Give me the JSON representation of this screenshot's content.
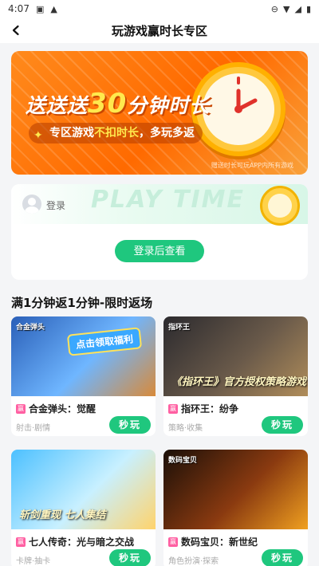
{
  "status_bar": {
    "time": "4:07"
  },
  "nav": {
    "title": "玩游戏赢时长专区"
  },
  "banner": {
    "headline_prefix": "送送送",
    "headline_number": "30",
    "headline_suffix": "分钟时长",
    "sub_part1": "专区游戏",
    "sub_highlight": "不扣时长",
    "sub_part2": "，多玩多返",
    "note": "赠送时长可玩APP内所有游戏"
  },
  "login_card": {
    "bg_text": "PLAY TIME",
    "login_label": "登录",
    "login_button": "登录后查看"
  },
  "section": {
    "title": "满1分钟返1分钟-限时返场"
  },
  "games": [
    {
      "tag": "赢",
      "name": "合金弹头：觉醒",
      "genre": "射击·剧情",
      "play": "秒玩",
      "cover_logo": "合金弹头",
      "cover_badge": "点击领取福利",
      "cover_colors": [
        "#2a5fb8",
        "#6fb6ff",
        "#d88a3a"
      ]
    },
    {
      "tag": "赢",
      "name": "指环王：纷争",
      "genre": "策略·收集",
      "play": "秒玩",
      "cover_logo": "指环王",
      "cover_text": "《指环王》官方授权策略游戏",
      "cover_colors": [
        "#2b2a2e",
        "#6a5a4a",
        "#b08d5a"
      ]
    },
    {
      "tag": "赢",
      "name": "七人传奇：光与暗之交战",
      "genre": "卡牌·抽卡",
      "play": "秒玩",
      "cover_text": "斩剑重现 七人集结",
      "cover_colors": [
        "#4cc0ff",
        "#c8f0ff",
        "#ffd36b"
      ]
    },
    {
      "tag": "赢",
      "name": "数码宝贝：新世纪",
      "genre": "角色扮演·探索",
      "play": "秒玩",
      "cover_logo": "数码宝贝",
      "cover_colors": [
        "#1a0f08",
        "#8a3a10",
        "#f0a020"
      ]
    }
  ]
}
